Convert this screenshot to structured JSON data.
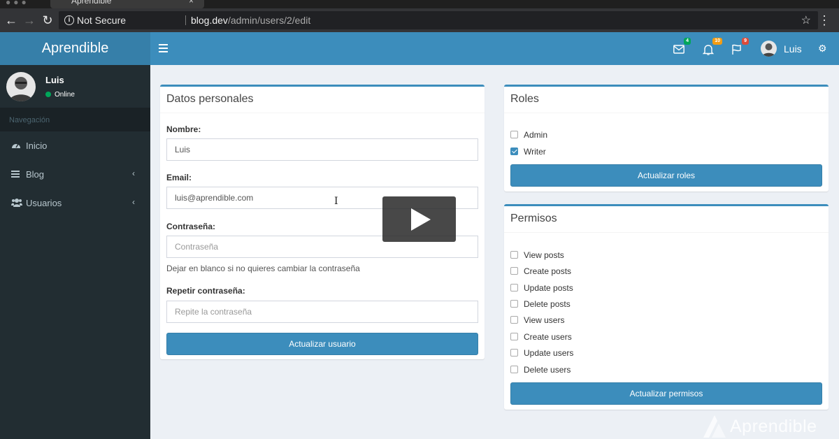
{
  "browser": {
    "tab_title": "Aprendible",
    "tab_close": "×",
    "security_label": "Not Secure",
    "url_host": "blog.dev",
    "url_path": "/admin/users/2/edit"
  },
  "app": {
    "brand": "Aprendible",
    "header_user": "Luis",
    "badges": {
      "messages": "4",
      "notifications": "10",
      "flags": "9"
    },
    "colors": {
      "primary": "#3c8dbc",
      "primary_dark": "#367fa9",
      "sidebar": "#222d32",
      "online": "#00a65a",
      "badge_green": "#00a65a",
      "badge_orange": "#f39c12",
      "badge_red": "#dd4b39"
    }
  },
  "sidebar": {
    "user_name": "Luis",
    "user_status": "Online",
    "nav_header": "Navegación",
    "items": [
      {
        "label": "Inicio",
        "icon": "dashboard-icon"
      },
      {
        "label": "Blog",
        "icon": "bars-icon"
      },
      {
        "label": "Usuarios",
        "icon": "users-icon"
      }
    ]
  },
  "personal": {
    "title": "Datos personales",
    "name_label": "Nombre:",
    "name_value": "Luis",
    "email_label": "Email:",
    "email_value": "luis@aprendible.com",
    "password_label": "Contraseña:",
    "password_placeholder": "Contraseña",
    "password_help": "Dejar en blanco si no quieres cambiar la contraseña",
    "repeat_label": "Repetir contraseña:",
    "repeat_placeholder": "Repite la contraseña",
    "submit": "Actualizar usuario"
  },
  "roles": {
    "title": "Roles",
    "items": [
      {
        "label": "Admin",
        "checked": false
      },
      {
        "label": "Writer",
        "checked": true
      }
    ],
    "submit": "Actualizar roles"
  },
  "permissions": {
    "title": "Permisos",
    "items": [
      {
        "label": "View posts",
        "checked": false
      },
      {
        "label": "Create posts",
        "checked": false
      },
      {
        "label": "Update posts",
        "checked": false
      },
      {
        "label": "Delete posts",
        "checked": false
      },
      {
        "label": "View users",
        "checked": false
      },
      {
        "label": "Create users",
        "checked": false
      },
      {
        "label": "Update users",
        "checked": false
      },
      {
        "label": "Delete users",
        "checked": false
      }
    ],
    "submit": "Actualizar permisos"
  },
  "watermark": "Aprendible"
}
